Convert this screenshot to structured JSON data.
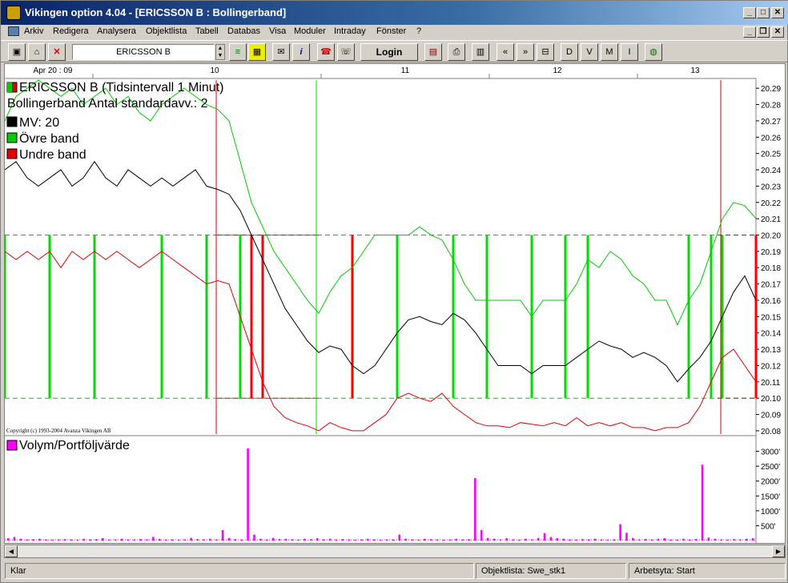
{
  "window": {
    "title": "Vikingen option 4.04 - [ERICSSON B : Bollingerband]"
  },
  "menu": [
    "Arkiv",
    "Redigera",
    "Analysera",
    "Objektlista",
    "Tabell",
    "Databas",
    "Visa",
    "Moduler",
    "Intraday",
    "Fönster",
    "?"
  ],
  "toolbar": {
    "symbol_value": "ERICSSON B",
    "login_label": "Login",
    "letter_buttons": [
      "D",
      "V",
      "M",
      "I"
    ]
  },
  "status": {
    "left": "Klar",
    "objektlista": "Objektlista: Swe_stk1",
    "arbetsyta": "Arbetsyta: Start"
  },
  "colors": {
    "price_line": "#000000",
    "upper_band": "#00cc00",
    "lower_band": "#e00000",
    "volume": "#ff00ff",
    "signal_green": "#00dd00",
    "signal_red": "#ff0000"
  },
  "chart_data": [
    {
      "type": "line",
      "title": "ERICSSON B (Tidsintervall 1 Minut)",
      "subtitle": "Bollingerband  Antal standardavv.: 2",
      "copyright": "Copyright (c) 1993-2004 Avanza Vikingen AB",
      "x_tick_labels": [
        "Apr 20 : 09",
        "10",
        "11",
        "12",
        "13"
      ],
      "y_ticks": [
        "20.29",
        "20.28",
        "20.27",
        "20.26",
        "20.25",
        "20.24",
        "20.23",
        "20.22",
        "20.21",
        "20.20",
        "20.19",
        "20.18",
        "20.17",
        "20.16",
        "20.15",
        "20.14",
        "20.13",
        "20.12",
        "20.11",
        "20.10",
        "20.09",
        "20.08"
      ],
      "ylim": [
        20.078,
        20.295
      ],
      "reference_lines": [
        20.2,
        20.1
      ],
      "series": [
        {
          "name": "MV: 20",
          "color": "#000000",
          "values": [
            20.24,
            20.245,
            20.235,
            20.23,
            20.235,
            20.24,
            20.23,
            20.235,
            20.245,
            20.235,
            20.23,
            20.24,
            20.235,
            20.23,
            20.235,
            20.23,
            20.235,
            20.24,
            20.23,
            20.228,
            20.225,
            20.215,
            20.2,
            20.185,
            20.17,
            20.155,
            20.145,
            20.135,
            20.128,
            20.132,
            20.13,
            20.12,
            20.115,
            20.12,
            20.13,
            20.14,
            20.148,
            20.15,
            20.147,
            20.145,
            20.152,
            20.148,
            20.14,
            20.13,
            20.12,
            20.12,
            20.12,
            20.115,
            20.12,
            20.12,
            20.12,
            20.125,
            20.13,
            20.135,
            20.132,
            20.13,
            20.125,
            20.128,
            20.125,
            20.12,
            20.11,
            20.118,
            20.125,
            20.135,
            20.15,
            20.165,
            20.175,
            20.16
          ]
        },
        {
          "name": "Övre band",
          "color": "#00cc00",
          "values": [
            20.27,
            20.285,
            20.29,
            20.295,
            20.29,
            20.285,
            20.29,
            20.28,
            20.285,
            20.29,
            20.28,
            20.285,
            20.275,
            20.27,
            20.28,
            20.285,
            20.29,
            20.285,
            20.28,
            20.277,
            20.27,
            20.245,
            20.22,
            20.205,
            20.19,
            20.18,
            20.17,
            20.16,
            20.152,
            20.165,
            20.175,
            20.18,
            20.19,
            20.2,
            20.2,
            20.2,
            20.2,
            20.205,
            20.2,
            20.197,
            20.185,
            20.17,
            20.16,
            20.16,
            20.16,
            20.16,
            20.16,
            20.15,
            20.16,
            20.16,
            20.16,
            20.17,
            20.185,
            20.18,
            20.19,
            20.185,
            20.175,
            20.17,
            20.16,
            20.16,
            20.145,
            20.16,
            20.17,
            20.19,
            20.21,
            20.22,
            20.218,
            20.21
          ]
        },
        {
          "name": "Undre band",
          "color": "#e00000",
          "values": [
            20.19,
            20.185,
            20.19,
            20.185,
            20.19,
            20.18,
            20.19,
            20.185,
            20.19,
            20.185,
            20.19,
            20.185,
            20.18,
            20.185,
            20.19,
            20.185,
            20.18,
            20.175,
            20.17,
            20.172,
            20.17,
            20.15,
            20.13,
            20.11,
            20.095,
            20.088,
            20.085,
            20.083,
            20.08,
            20.085,
            20.082,
            20.08,
            20.08,
            20.085,
            20.09,
            20.1,
            20.103,
            20.1,
            20.098,
            20.103,
            20.095,
            20.09,
            20.085,
            20.083,
            20.083,
            20.082,
            20.085,
            20.084,
            20.083,
            20.085,
            20.083,
            20.088,
            20.083,
            20.085,
            20.083,
            20.085,
            20.082,
            20.082,
            20.08,
            20.082,
            20.082,
            20.085,
            20.095,
            20.11,
            20.125,
            20.13,
            20.12,
            20.11
          ]
        }
      ],
      "buy_signals_index": [
        0,
        4,
        8,
        14,
        18,
        21,
        35,
        40,
        43,
        47,
        50,
        52,
        61,
        63,
        64,
        67
      ],
      "sell_signals_index": [
        22,
        23,
        31,
        67
      ]
    },
    {
      "type": "bar",
      "title": "Volym/Portföljvärde",
      "y_ticks": [
        "3000'",
        "2500'",
        "2000'",
        "1500'",
        "1000'",
        "500'"
      ],
      "ylim": [
        0,
        3150
      ],
      "values": [
        80,
        120,
        60,
        40,
        50,
        60,
        40,
        30,
        40,
        50,
        40,
        30,
        60,
        40,
        50,
        80,
        30,
        40,
        60,
        40,
        30,
        50,
        40,
        120,
        60,
        30,
        40,
        30,
        40,
        90,
        50,
        40,
        60,
        40,
        350,
        90,
        50,
        30,
        3100,
        200,
        60,
        40,
        90,
        50,
        60,
        40,
        30,
        60,
        50,
        80,
        40,
        60,
        40,
        50,
        40,
        30,
        40,
        60,
        40,
        30,
        40,
        40,
        200,
        60,
        40,
        30,
        60,
        50,
        40,
        30,
        40,
        60,
        40,
        50,
        2100,
        350,
        90,
        60,
        40,
        80,
        40,
        30,
        60,
        40,
        90,
        250,
        120,
        80,
        60,
        40,
        30,
        50,
        40,
        60,
        40,
        30,
        40,
        550,
        260,
        90,
        40,
        50,
        40,
        60,
        80,
        40,
        30,
        60,
        40,
        50,
        2550,
        100,
        60,
        40,
        30,
        50,
        40,
        60,
        80
      ]
    }
  ]
}
